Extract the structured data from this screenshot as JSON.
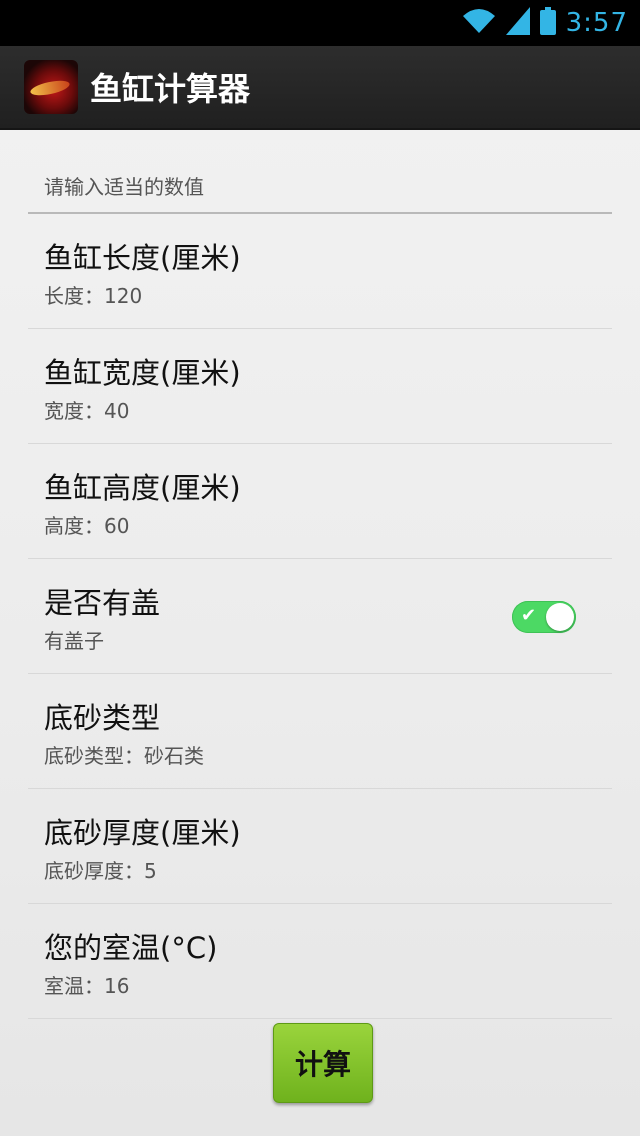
{
  "status_bar": {
    "time": "3:57",
    "icons": [
      "wifi-icon",
      "signal-icon",
      "battery-icon"
    ]
  },
  "app_bar": {
    "title": "鱼缸计算器"
  },
  "section": {
    "header": "请输入适当的数值"
  },
  "preferences": [
    {
      "title": "鱼缸长度(厘米)",
      "summary": "长度：120"
    },
    {
      "title": "鱼缸宽度(厘米)",
      "summary": "宽度：40"
    },
    {
      "title": "鱼缸高度(厘米)",
      "summary": "高度：60"
    },
    {
      "title": "是否有盖",
      "summary": "有盖子",
      "toggle": true
    },
    {
      "title": "底砂类型",
      "summary": "底砂类型：砂石类"
    },
    {
      "title": "底砂厚度(厘米)",
      "summary": "底砂厚度：5"
    },
    {
      "title": "您的室温(°C)",
      "summary": "室温：16"
    }
  ],
  "calc_button": {
    "label": "计算"
  },
  "colors": {
    "accent": "#33b5e5",
    "toggle_on": "#4cd964",
    "button_green": "#7fc02a"
  }
}
